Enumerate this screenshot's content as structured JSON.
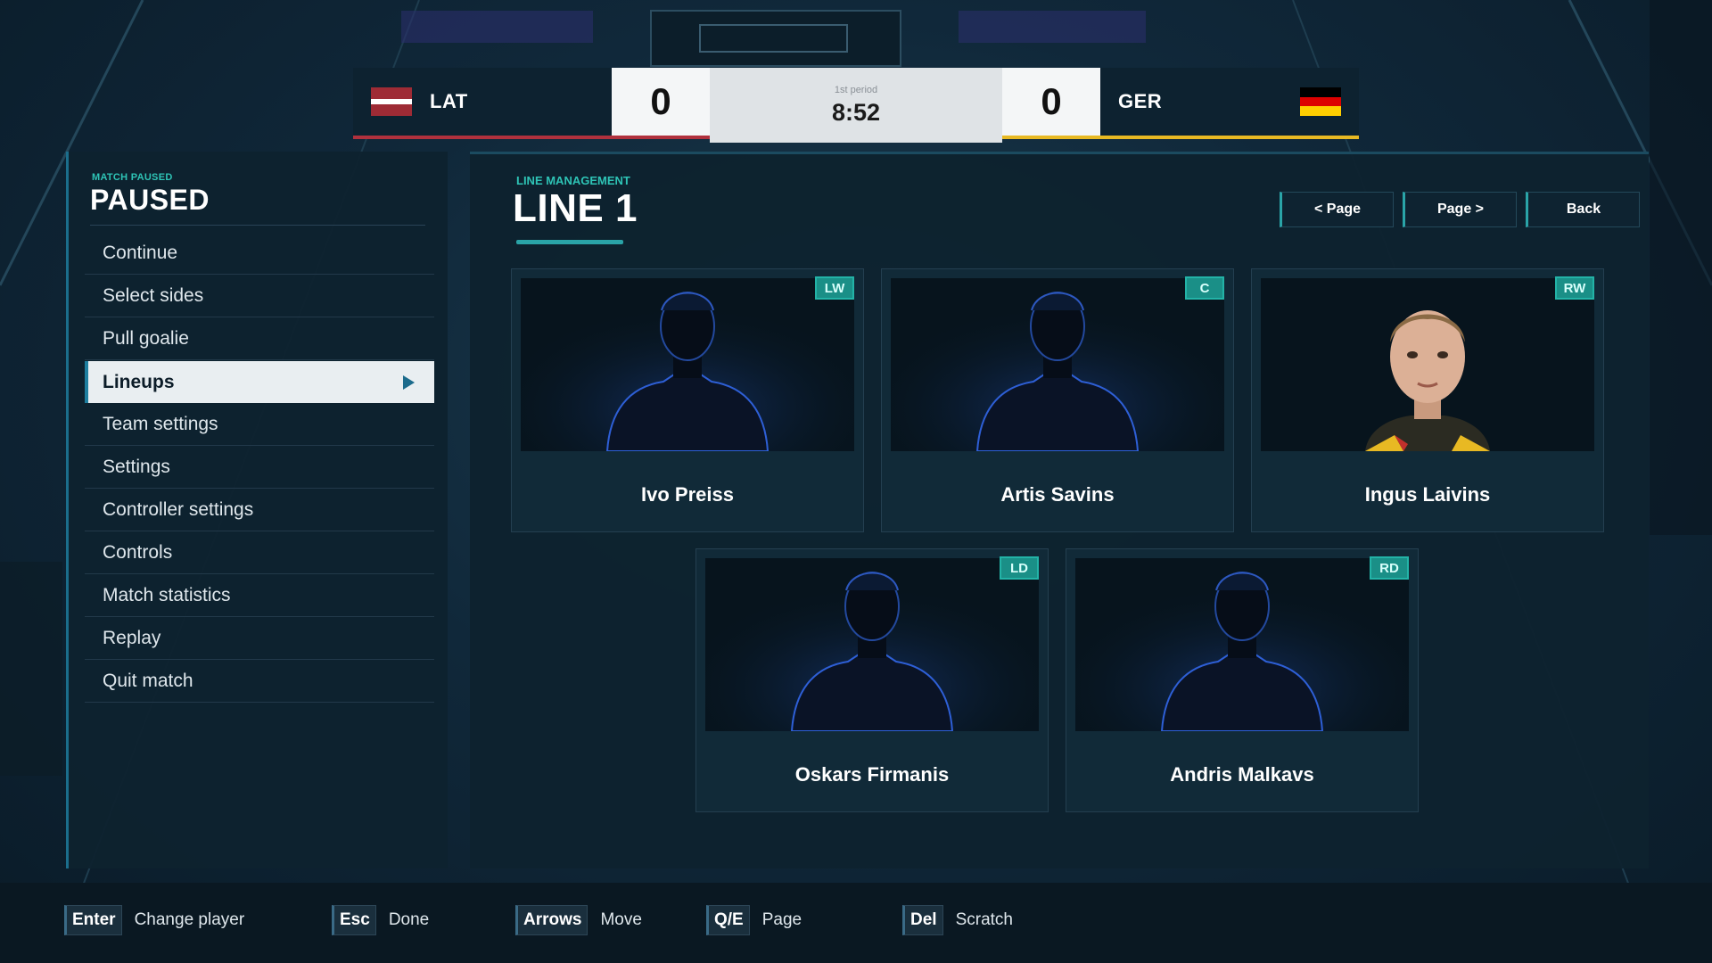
{
  "scoreboard": {
    "home": {
      "abbr": "LAT",
      "score": "0",
      "color": "#b0313d"
    },
    "away": {
      "abbr": "GER",
      "score": "0",
      "color": "#e8b923"
    },
    "period": "1st period",
    "time": "8:52"
  },
  "pause_menu": {
    "subtitle": "MATCH PAUSED",
    "title": "PAUSED",
    "items": [
      {
        "label": "Continue",
        "selected": false
      },
      {
        "label": "Select sides",
        "selected": false
      },
      {
        "label": "Pull goalie",
        "selected": false
      },
      {
        "label": "Lineups",
        "selected": true
      },
      {
        "label": "Team settings",
        "selected": false
      },
      {
        "label": "Settings",
        "selected": false
      },
      {
        "label": "Controller settings",
        "selected": false
      },
      {
        "label": "Controls",
        "selected": false
      },
      {
        "label": "Match statistics",
        "selected": false
      },
      {
        "label": "Replay",
        "selected": false
      },
      {
        "label": "Quit match",
        "selected": false
      }
    ]
  },
  "line_management": {
    "subtitle": "LINE MANAGEMENT",
    "title": "LINE 1",
    "buttons": {
      "prev_page": "< Page",
      "next_page": "Page >",
      "back": "Back"
    },
    "players": [
      {
        "position": "LW",
        "name": "Ivo Preiss",
        "photo": "silhouette-icon"
      },
      {
        "position": "C",
        "name": "Artis Savins",
        "photo": "silhouette-icon"
      },
      {
        "position": "RW",
        "name": "Ingus Laivins",
        "photo": "player-portrait"
      },
      {
        "position": "LD",
        "name": "Oskars Firmanis",
        "photo": "silhouette-icon"
      },
      {
        "position": "RD",
        "name": "Andris Malkavs",
        "photo": "silhouette-icon"
      }
    ]
  },
  "footer_hints": [
    {
      "key": "Enter",
      "label": "Change player"
    },
    {
      "key": "Esc",
      "label": "Done"
    },
    {
      "key": "Arrows",
      "label": "Move"
    },
    {
      "key": "Q/E",
      "label": "Page"
    },
    {
      "key": "Del",
      "label": "Scratch"
    }
  ],
  "colors": {
    "accent": "#2ec4b6",
    "panel": "#0e222f",
    "badge": "#1a8f87"
  }
}
